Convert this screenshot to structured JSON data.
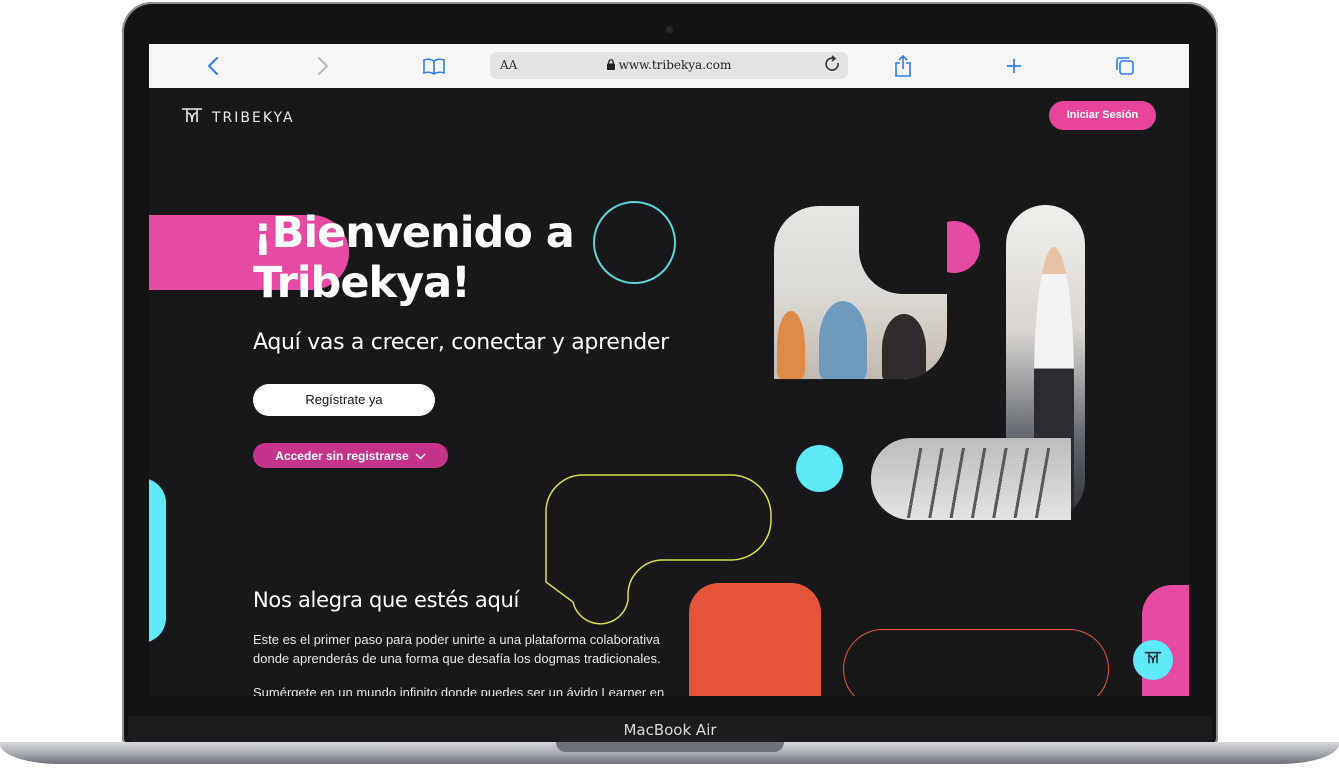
{
  "device": {
    "model_label": "MacBook Air"
  },
  "browser": {
    "url": "www.tribekya.com",
    "text_size_label": "AA",
    "toolbar_icons": [
      "back-icon",
      "forward-icon",
      "bookmarks-icon",
      "lock-icon",
      "reload-icon",
      "share-icon",
      "new-tab-icon",
      "tabs-icon"
    ]
  },
  "header": {
    "logo_text": "TRIBEKYA",
    "login_label": "Iniciar Sesión"
  },
  "hero": {
    "title_line1": "¡Bienvenido a",
    "title_line2": "Tribekya!",
    "subtitle": "Aquí vas a crecer, conectar y aprender",
    "register_label": "Regístrate ya",
    "guest_label": "Acceder sin registrarse"
  },
  "welcome": {
    "title": "Nos alegra que estés aquí",
    "paragraph1": "Este es el primer paso para poder unirte a una plataforma colaborativa donde aprenderás de una forma que desafía los dogmas tradicionales.",
    "paragraph2": "Sumérgete en un mundo infinito donde puedes ser un ávido Learner en"
  },
  "colors": {
    "background": "#18181a",
    "pink": "#e64aa2",
    "magenta_button": "#c6338a",
    "cyan": "#5fe8f8",
    "orange": "#e6553a",
    "yellow_outline": "#d7e04a"
  }
}
